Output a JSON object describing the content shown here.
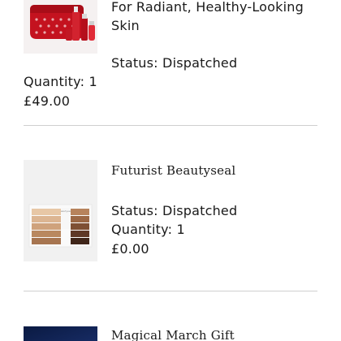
{
  "orders": {
    "items": [
      {
        "name_line1": "For Radiant, Healthy-Looking",
        "name_line2": "Skin",
        "status": "Status: Dispatched",
        "quantity": "Quantity: 1",
        "price": "£49.00"
      },
      {
        "name": "Futurist Beautyseal",
        "status": "Status: Dispatched",
        "quantity": "Quantity: 1",
        "price": "£0.00",
        "swatch_label": "Beautyseal"
      },
      {
        "name": "Magical March Gift"
      }
    ]
  }
}
